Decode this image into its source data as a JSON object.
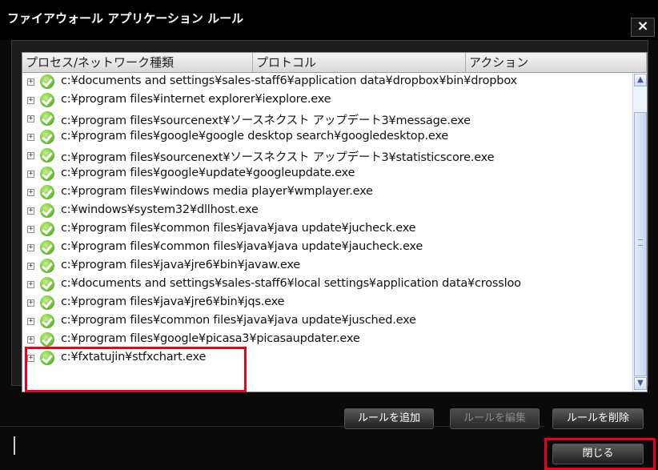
{
  "window": {
    "title": "ファイアウォール アプリケーション ルール",
    "close_label": "×"
  },
  "columns": [
    "プロセス/ネットワーク種類",
    "プロトコル",
    "アクション"
  ],
  "rows": [
    "c:¥documents and settings¥sales-staff6¥application data¥dropbox¥bin¥dropbox",
    "c:¥program files¥internet explorer¥iexplore.exe",
    "c:¥program files¥sourcenext¥ソースネクスト アップデート3¥message.exe",
    "c:¥program files¥google¥google desktop search¥googledesktop.exe",
    "c:¥program files¥sourcenext¥ソースネクスト アップデート3¥statisticscore.exe",
    "c:¥program files¥google¥update¥googleupdate.exe",
    "c:¥program files¥windows media player¥wmplayer.exe",
    "c:¥windows¥system32¥dllhost.exe",
    "c:¥program files¥common files¥java¥java update¥jucheck.exe",
    "c:¥program files¥common files¥java¥java update¥jaucheck.exe",
    "c:¥program files¥java¥jre6¥bin¥javaw.exe",
    "c:¥documents and settings¥sales-staff6¥local settings¥application data¥crossloo",
    "c:¥program files¥java¥jre6¥bin¥jqs.exe",
    "c:¥program files¥common files¥java¥java update¥jusched.exe",
    "c:¥program files¥google¥picasa3¥picasaupdater.exe",
    "c:¥fxtatujin¥stfxchart.exe"
  ],
  "buttons": {
    "add": "ルールを追加",
    "edit": "ルールを編集",
    "delete": "ルールを削除",
    "close": "閉じる"
  },
  "scrollbar": {
    "up": "▲",
    "down": "▼"
  },
  "colors": {
    "highlight": "#e8001c",
    "check": "#5cb826"
  }
}
